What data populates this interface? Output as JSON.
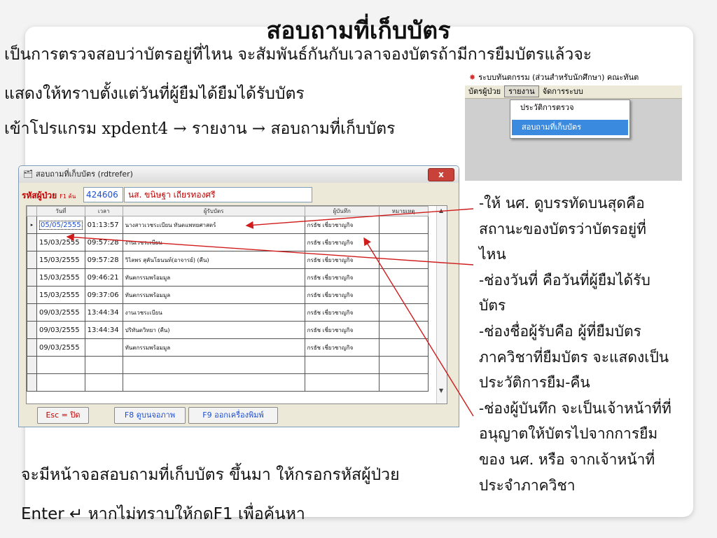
{
  "slide": {
    "title": "สอบถามที่เก็บบัตร",
    "intro_line1": "เป็นการตรวจสอบว่าบัตรอยู่ที่ไหน จะสัมพันธ์กันกับเวลาจองบัตรถ้ามีการยืมบัตรแล้วจะ",
    "intro_line2": "แสดงให้ทราบตั้งแต่วันที่ผู้ยืมได้ยืมได้รับบัตร",
    "intro_line3": "เข้าโปรแกรม xpdent4 → รายงาน → สอบถามที่เก็บบัตร",
    "bottom_line1": "จะมีหน้าจอสอบถามที่เก็บบัตร ขึ้นมา ให้กรอกรหัสผู้ป่วย",
    "bottom_line2": "Enter ↵ หากไม่ทราบให้กดF1 เพื่อค้นหา",
    "notes": [
      "-ให้ นศ. ดูบรรทัดบนสุดคือ",
      "สถานะของบัตรว่าบัตรอยู่ที่",
      "ไหน",
      "-ช่องวันที่ คือวันที่ผู้ยืมได้รับ",
      "บัตร",
      "-ช่องชื่อผู้รับคือ ผู้ที่ยืมบัตร",
      "ภาควิชาที่ยืมบัตร จะแสดงเป็น",
      "ประวัติการยืม-คืน",
      "-ช่องผู้บันทึก จะเป็นเจ้าหน้าที่ที่",
      "อนุญาตให้บัตรไปจากการยืม",
      "ของ นศ. หรือ จากเจ้าหน้าที่",
      "ประจำภาควิชา"
    ]
  },
  "menu_shot": {
    "app_title": "ระบบทันตกรรม (ส่วนสำหรับนักศึกษา) คณะทันต",
    "menubar": [
      "บัตรผู้ป่วย",
      "รายงาน",
      "จัดการระบบ"
    ],
    "dropdown": [
      "ประวัติการตรวจ",
      "สอบถามที่เก็บบัตร"
    ]
  },
  "window": {
    "title": "สอบถามที่เก็บบัตร (rdtrefer)",
    "close": "x",
    "patient_id_label": "รหัสผู้ป่วย",
    "patient_id_hint": "F1 ค้น",
    "patient_id": "424606",
    "patient_name": "นส. ขนิษฐา เถียรทองศรี",
    "columns": [
      "วันที่",
      "เวลา",
      "ผู้รับบัตร",
      "ผู้บันทึก",
      "หมายเหตุ"
    ],
    "rows": [
      {
        "date": "05/05/2555",
        "time": "01:13:57",
        "receiver": "นางสาวเวชระเบียน ทันตแพทยศาสตร์",
        "recorder": "กรธัช เชี่ยวชาญกิจ",
        "note": ""
      },
      {
        "date": "15/03/2555",
        "time": "09:57:28",
        "receiver": "งานเวชระเบียน",
        "recorder": "กรธัช เชี่ยวชาญกิจ",
        "note": ""
      },
      {
        "date": "15/03/2555",
        "time": "09:57:28",
        "receiver": "วิไลพร สุคันโธนนท์(อาจารย์) (คืน)",
        "recorder": "กรธัช เชี่ยวชาญกิจ",
        "note": ""
      },
      {
        "date": "15/03/2555",
        "time": "09:46:21",
        "receiver": "ทันตกรรมพร้อมมูล",
        "recorder": "กรธัช เชี่ยวชาญกิจ",
        "note": ""
      },
      {
        "date": "15/03/2555",
        "time": "09:37:06",
        "receiver": "ทันตกรรมพร้อมมูล",
        "recorder": "กรธัช เชี่ยวชาญกิจ",
        "note": ""
      },
      {
        "date": "09/03/2555",
        "time": "13:44:34",
        "receiver": "งานเวชระเบียน",
        "recorder": "กรธัช เชี่ยวชาญกิจ",
        "note": ""
      },
      {
        "date": "09/03/2555",
        "time": "13:44:34",
        "receiver": "ปริทันตวิทยา (คืน)",
        "recorder": "กรธัช เชี่ยวชาญกิจ",
        "note": ""
      },
      {
        "date": "09/03/2555",
        "time": "",
        "receiver": "ทันตกรรมพร้อมมูล",
        "recorder": "กรธัช เชี่ยวชาญกิจ",
        "note": ""
      }
    ],
    "btn_esc": "Esc = ปิด",
    "btn_f8": "F8 ดูบนจอภาพ",
    "btn_f9": "F9 ออกเครื่องพิมพ์"
  },
  "colors": {
    "accent_red": "#c00000",
    "accent_blue": "#1a4fd6",
    "arrow": "#d01c1c"
  }
}
